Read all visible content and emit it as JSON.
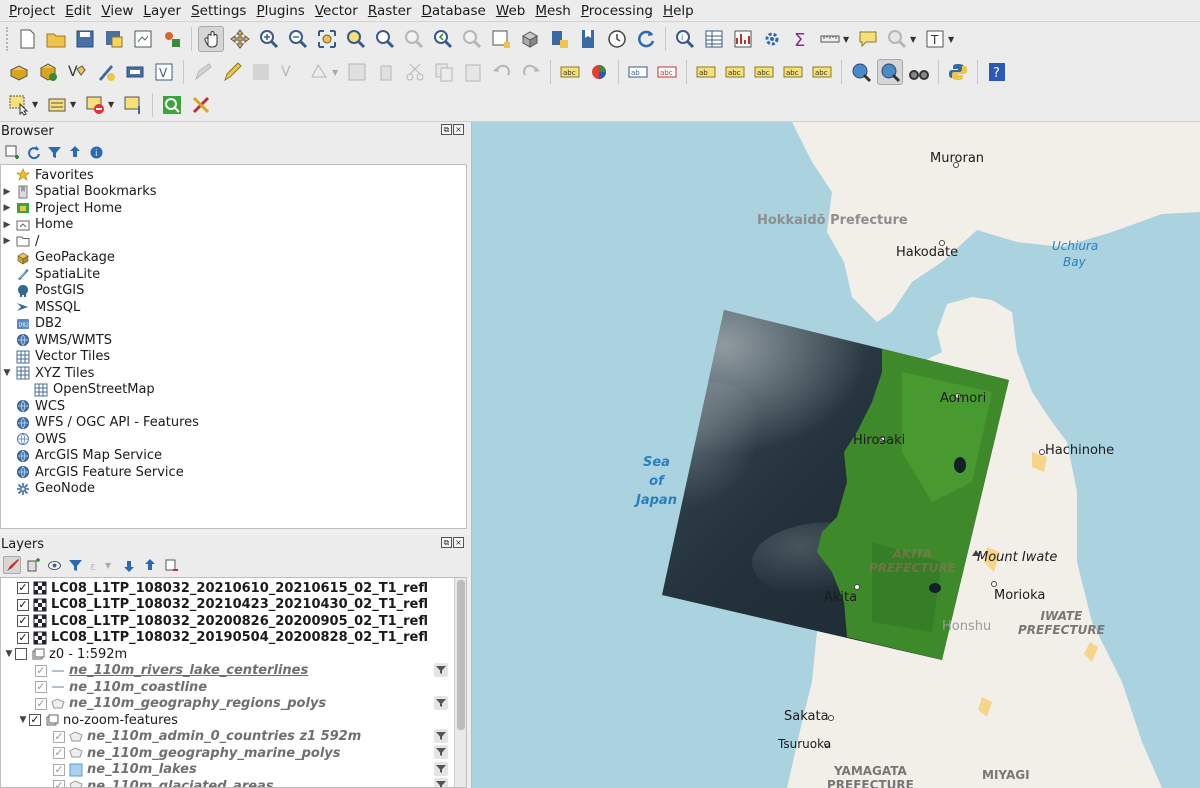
{
  "menu": [
    "Project",
    "Edit",
    "View",
    "Layer",
    "Settings",
    "Plugins",
    "Vector",
    "Raster",
    "Database",
    "Web",
    "Mesh",
    "Processing",
    "Help"
  ],
  "browser": {
    "title": "Browser",
    "items": [
      {
        "label": "Favorites",
        "icon": "star-icon",
        "arrow": ""
      },
      {
        "label": "Spatial Bookmarks",
        "icon": "bookmark-icon",
        "arrow": "▶"
      },
      {
        "label": "Project Home",
        "icon": "project-home-icon",
        "arrow": "▶"
      },
      {
        "label": "Home",
        "icon": "home-folder-icon",
        "arrow": "▶"
      },
      {
        "label": "/",
        "icon": "folder-icon",
        "arrow": "▶"
      },
      {
        "label": "GeoPackage",
        "icon": "geopackage-icon",
        "arrow": ""
      },
      {
        "label": "SpatiaLite",
        "icon": "spatialite-icon",
        "arrow": ""
      },
      {
        "label": "PostGIS",
        "icon": "postgis-icon",
        "arrow": ""
      },
      {
        "label": "MSSQL",
        "icon": "mssql-icon",
        "arrow": ""
      },
      {
        "label": "DB2",
        "icon": "db2-icon",
        "arrow": ""
      },
      {
        "label": "WMS/WMTS",
        "icon": "globe-icon",
        "arrow": ""
      },
      {
        "label": "Vector Tiles",
        "icon": "grid-icon",
        "arrow": ""
      },
      {
        "label": "XYZ Tiles",
        "icon": "grid-icon",
        "arrow": "▼"
      },
      {
        "label": "OpenStreetMap",
        "icon": "grid-icon",
        "arrow": "",
        "indent": true
      },
      {
        "label": "WCS",
        "icon": "globe-icon",
        "arrow": ""
      },
      {
        "label": "WFS / OGC API - Features",
        "icon": "globe-icon",
        "arrow": ""
      },
      {
        "label": "OWS",
        "icon": "globe-outline-icon",
        "arrow": ""
      },
      {
        "label": "ArcGIS Map Service",
        "icon": "globe-icon",
        "arrow": ""
      },
      {
        "label": "ArcGIS Feature Service",
        "icon": "globe-icon",
        "arrow": ""
      },
      {
        "label": "GeoNode",
        "icon": "geonode-icon",
        "arrow": ""
      }
    ]
  },
  "layers": {
    "title": "Layers",
    "items": [
      {
        "label": "LC08_L1TP_108032_20210610_20210615_02_T1_refl",
        "style": "bold",
        "checked": true
      },
      {
        "label": "LC08_L1TP_108032_20210423_20210430_02_T1_refl",
        "style": "bold",
        "checked": true
      },
      {
        "label": "LC08_L1TP_108032_20200826_20200905_02_T1_refl",
        "style": "bold",
        "checked": true
      },
      {
        "label": "LC08_L1TP_108032_20190504_20200828_02_T1_refl",
        "style": "bold",
        "checked": true
      },
      {
        "label": "z0 - 1:592m",
        "style": "group",
        "checked": false
      },
      {
        "label": "ne_110m_rivers_lake_centerlines",
        "style": "italic-ul",
        "checked": true,
        "filter": true
      },
      {
        "label": "ne_110m_coastline",
        "style": "italic",
        "checked": true
      },
      {
        "label": "ne_110m_geography_regions_polys",
        "style": "italic",
        "checked": true,
        "filter": true
      },
      {
        "label": "no-zoom-features",
        "style": "group2",
        "checked": true
      },
      {
        "label": "ne_110m_admin_0_countries z1 592m",
        "style": "italic",
        "checked": true,
        "filter": true
      },
      {
        "label": "ne_110m_geography_marine_polys",
        "style": "italic",
        "checked": true,
        "filter": true
      },
      {
        "label": "ne_110m_lakes",
        "style": "italic",
        "checked": true,
        "filter": true
      },
      {
        "label": "ne_110m_glaciated_areas",
        "style": "italic",
        "checked": true,
        "filter": true
      }
    ]
  },
  "map": {
    "labels": {
      "muroran": "Muroran",
      "hokkaido": "Hokkaidō Prefecture",
      "hakodate": "Hakodate",
      "uchiura1": "Uchiura",
      "uchiura2": "Bay",
      "aomori": "Aomori",
      "hirosaki": "Hirosaki",
      "hachinohe": "Hachinohe",
      "sea1": "Sea",
      "sea2": "of",
      "sea3": "Japan",
      "akita_pref1": "AKITA",
      "akita_pref2": "PREFECTURE",
      "mount_iwate": "Mount Iwate",
      "akita": "Akita",
      "morioka": "Morioka",
      "iwate1": "IWATE",
      "iwate2": "PREFECTURE",
      "honshu": "Honshu",
      "sakata": "Sakata",
      "tsuruoka": "Tsuruoka",
      "yamagata1": "YAMAGATA",
      "yamagata2": "PREFECTURE",
      "miyagi": "MIYAGI"
    }
  }
}
